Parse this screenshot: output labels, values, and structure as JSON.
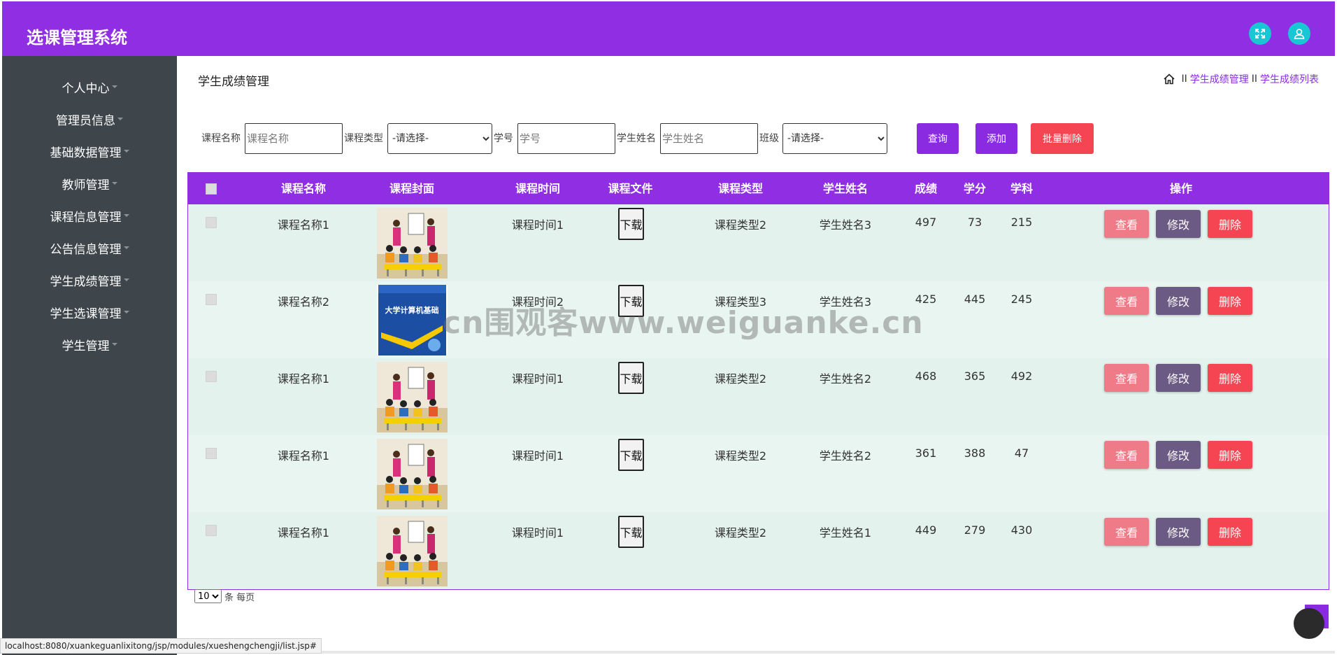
{
  "header": {
    "title": "选课管理系统",
    "fullscreen_icon": "fullscreen-icon",
    "user_icon": "user-icon",
    "accent": "#902ee3"
  },
  "sidebar": {
    "items": [
      {
        "label": "个人中心"
      },
      {
        "label": "管理员信息"
      },
      {
        "label": "基础数据管理"
      },
      {
        "label": "教师管理"
      },
      {
        "label": "课程信息管理"
      },
      {
        "label": "公告信息管理"
      },
      {
        "label": "学生成绩管理"
      },
      {
        "label": "学生选课管理"
      },
      {
        "label": "学生管理"
      }
    ]
  },
  "page": {
    "title": "学生成绩管理",
    "breadcrumb": {
      "sep": "II",
      "item1": "学生成绩管理",
      "item2": "学生成绩列表"
    }
  },
  "filters": {
    "course_name_label": "课程名称",
    "course_name_placeholder": "课程名称",
    "course_type_label": "课程类型",
    "course_type_value": "-请选择-",
    "student_no_label": "学号",
    "student_no_placeholder": "学号",
    "student_name_label": "学生姓名",
    "student_name_placeholder": "学生姓名",
    "class_label": "班级",
    "class_value": "-请选择-",
    "query_label": "查询",
    "add_label": "添加",
    "batch_delete_label": "批量删除"
  },
  "table": {
    "headers": {
      "name": "课程名称",
      "cover": "课程封面",
      "time": "课程时间",
      "file": "课程文件",
      "type": "课程类型",
      "student": "学生姓名",
      "score": "成绩",
      "credit": "学分",
      "subject": "学科",
      "actions": "操作"
    },
    "rows": [
      {
        "name": "课程名称1",
        "cover": "classroom",
        "time": "课程时间1",
        "file": "下载",
        "type": "课程类型2",
        "student": "学生姓名3",
        "score": "497",
        "credit": "73",
        "subject": "215"
      },
      {
        "name": "课程名称2",
        "cover": "book",
        "time": "课程时间2",
        "file": "下载",
        "type": "课程类型3",
        "student": "学生姓名3",
        "score": "425",
        "credit": "445",
        "subject": "245"
      },
      {
        "name": "课程名称1",
        "cover": "classroom",
        "time": "课程时间1",
        "file": "下载",
        "type": "课程类型2",
        "student": "学生姓名2",
        "score": "468",
        "credit": "365",
        "subject": "492"
      },
      {
        "name": "课程名称1",
        "cover": "classroom",
        "time": "课程时间1",
        "file": "下载",
        "type": "课程类型2",
        "student": "学生姓名2",
        "score": "361",
        "credit": "388",
        "subject": "47"
      },
      {
        "name": "课程名称1",
        "cover": "classroom",
        "time": "课程时间1",
        "file": "下载",
        "type": "课程类型2",
        "student": "学生姓名1",
        "score": "449",
        "credit": "279",
        "subject": "430"
      }
    ],
    "actions": {
      "view": "查看",
      "edit": "修改",
      "delete": "删除"
    },
    "book_title": "大学计算机基础"
  },
  "pager": {
    "page_size": "10",
    "suffix": "条 每页"
  },
  "watermark": "cn围观客www.weiguanke.cn",
  "status_bar": "localhost:8080/xuankeguanlixitong/jsp/modules/xueshengchengji/list.jsp#"
}
